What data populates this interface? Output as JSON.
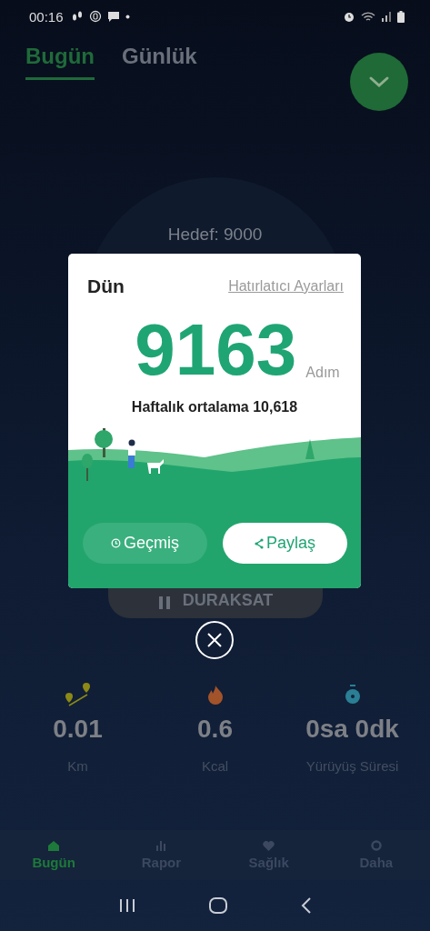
{
  "status_bar": {
    "time": "00:16"
  },
  "tabs": [
    {
      "label": "Bugün",
      "selected": true
    },
    {
      "label": "Günlük",
      "selected": false
    }
  ],
  "goal": "Hedef: 9000",
  "pause_button": "DURAKSAT",
  "stats": [
    {
      "kind": "distance",
      "value": "0.01",
      "unit": "Km"
    },
    {
      "kind": "calories",
      "value": "0.6",
      "unit": "Kcal"
    },
    {
      "kind": "time",
      "value": "0sa 0dk",
      "unit": "Yürüyüş Süresi"
    }
  ],
  "bottom_nav": [
    {
      "kind": "home",
      "label": "Bugün",
      "selected": true
    },
    {
      "kind": "report",
      "label": "Rapor",
      "selected": false
    },
    {
      "kind": "health",
      "label": "Sağlık",
      "selected": false
    },
    {
      "kind": "more",
      "label": "Daha",
      "selected": false
    }
  ],
  "dialog": {
    "title": "Dün",
    "link": "Hatırlatıcı Ayarları",
    "steps": "9163",
    "unit": "Adım",
    "summary": "Haftalık ortalama 10,618",
    "buttons": [
      {
        "kind": "history",
        "label": "Geçmiş"
      },
      {
        "kind": "share",
        "label": "Paylaş"
      }
    ]
  }
}
